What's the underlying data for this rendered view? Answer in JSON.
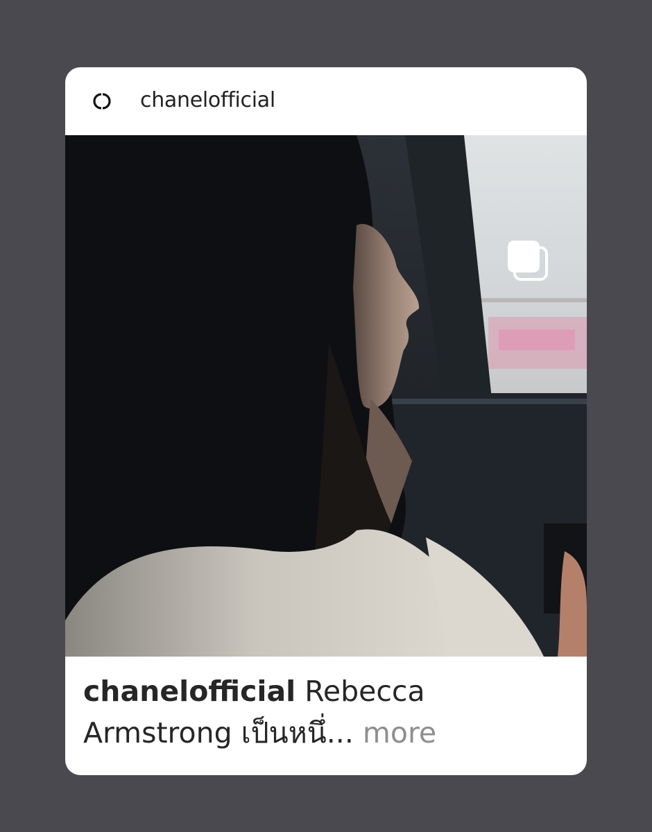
{
  "post": {
    "username": "chanelofficial",
    "brand_logo": "chanel-cc-logo",
    "media_icon": "carousel-multiple-icon",
    "caption": {
      "user": "chanelofficial",
      "line1_text": "Rebecca",
      "line2_text": "Armstrong เป็นหนึ่",
      "ellipsis": "...",
      "more_label": "more"
    }
  }
}
